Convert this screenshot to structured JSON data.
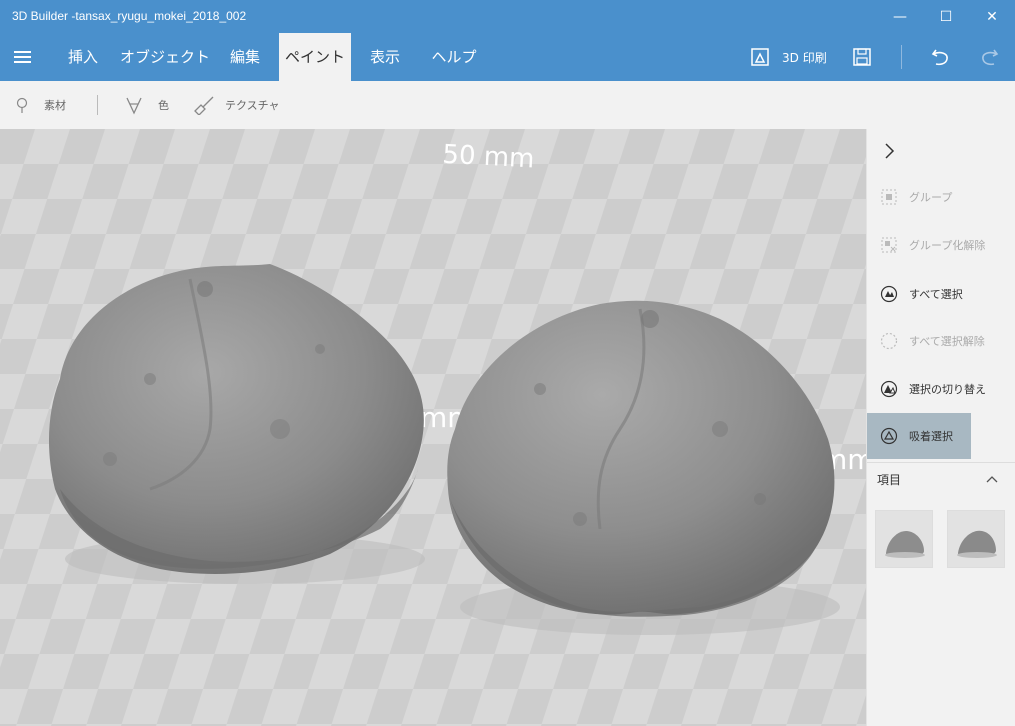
{
  "window": {
    "title": "3D Builder -tansax_ryugu_mokei_2018_002",
    "minimize_glyph": "—",
    "maximize_glyph": "☐",
    "close_glyph": "✕"
  },
  "menubar": {
    "tabs": [
      {
        "label": "挿入"
      },
      {
        "label": "オブジェクト"
      },
      {
        "label": "編集"
      },
      {
        "label": "ペイント"
      },
      {
        "label": "表示"
      },
      {
        "label": "ヘルプ"
      }
    ],
    "active_tab": "ペイント",
    "print_label": "3D 印刷"
  },
  "toolbar": {
    "material_label": "素材",
    "color_label": "色",
    "texture_label": "テクスチャ"
  },
  "viewport": {
    "scale_label": "50 mm",
    "side_label_left": "mm",
    "side_label_right": "mm"
  },
  "sidepanel": {
    "items": [
      {
        "label": "グループ",
        "enabled": false
      },
      {
        "label": "グループ化解除",
        "enabled": false
      },
      {
        "label": "すべて選択",
        "enabled": true
      },
      {
        "label": "すべて選択解除",
        "enabled": false
      },
      {
        "label": "選択の切り替え",
        "enabled": true
      },
      {
        "label": "吸着選択",
        "enabled": true,
        "selected": true
      }
    ],
    "section_label": "項目"
  },
  "colors": {
    "accent": "#4a90cc",
    "selected_item": "#a8b8c2",
    "panel_bg": "#f2f2f2"
  }
}
